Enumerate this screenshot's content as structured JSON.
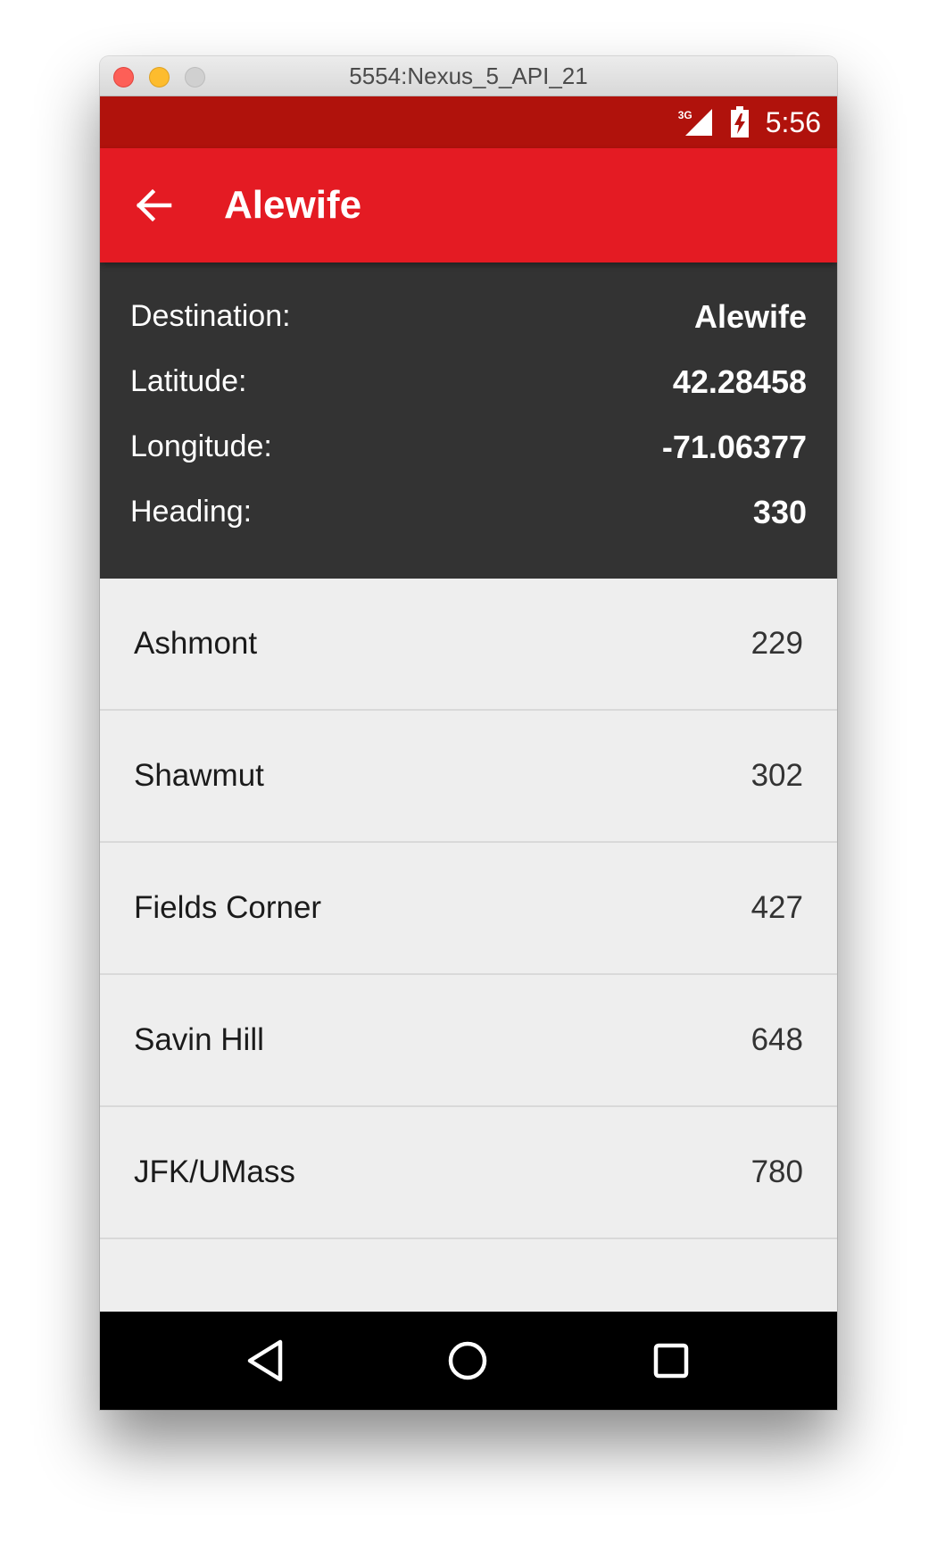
{
  "window": {
    "title": "5554:Nexus_5_API_21"
  },
  "status_bar": {
    "network": "3G",
    "time": "5:56",
    "icons": [
      "signal-icon",
      "battery-charging-icon"
    ]
  },
  "app_bar": {
    "title": "Alewife",
    "back_icon": "arrow-back-icon",
    "color": "#e41b23"
  },
  "info": {
    "rows": [
      {
        "label": "Destination:",
        "value": "Alewife"
      },
      {
        "label": "Latitude:",
        "value": "42.28458"
      },
      {
        "label": "Longitude:",
        "value": "-71.06377"
      },
      {
        "label": "Heading:",
        "value": "330"
      }
    ]
  },
  "stops": [
    {
      "name": "Ashmont",
      "value": "229"
    },
    {
      "name": "Shawmut",
      "value": "302"
    },
    {
      "name": "Fields Corner",
      "value": "427"
    },
    {
      "name": "Savin Hill",
      "value": "648"
    },
    {
      "name": "JFK/UMass",
      "value": "780"
    }
  ],
  "nav_bar": {
    "icons": [
      "back-triangle-icon",
      "home-circle-icon",
      "recents-square-icon"
    ]
  },
  "colors": {
    "status_bar": "#b0120c",
    "info_panel": "#333333",
    "list_background": "#eeeeee"
  }
}
